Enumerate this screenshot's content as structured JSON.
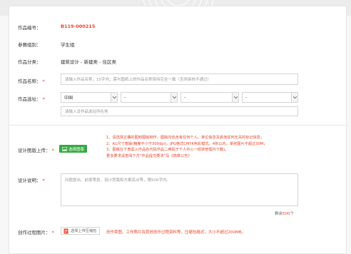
{
  "fields": {
    "work_number": {
      "label": "作品编号：",
      "value": "B119-000215"
    },
    "group": {
      "label": "参赛组别：",
      "value": "学生组"
    },
    "category": {
      "label": "作品分类：",
      "value": "建筑设计 - 新建类 - 住区类"
    },
    "work_name": {
      "label": "作品名称：",
      "required": "*",
      "placeholder": "请输入作品名称，15字内；需与图纸上的作品名称保持完全一致（否则审核不通过）"
    },
    "location": {
      "label": "作品选址：",
      "required": "*",
      "country": "中国",
      "province": "-",
      "city": "-",
      "district": "-",
      "address_placeholder": "请输入设作品选址所在地"
    },
    "design_upload": {
      "label": "设计图版上传：",
      "required": "*",
      "button_label": "选择图版",
      "notes": [
        "1、请选择正确的图到图版制作，图版内包含有任何个人、单位信息及其他任何无关的标记信息；",
        "2、A1尺寸宽版(精度不小于300dpi)，JPG格式CMYK色彩模式，4张以内，单张图片不超过30M；",
        "3、图版在下角需入作品名代码作品二维码于个人中心一经获管理内下载)。",
        "更多要求请查阅下方“作品提交要求”及《简章公告》"
      ]
    },
    "design_description": {
      "label": "设计说明：",
      "required": "*",
      "placeholder": "问题提出、前景策划、设计思路和方案亮点等，限500字内。",
      "counter_prefix": "剩余",
      "counter_value": "500",
      "counter_suffix": "个"
    },
    "process_images": {
      "label": "创作过程图片：",
      "required": "*",
      "button_label": "选择上传压缩包",
      "note": "创作草图、工作照片及其他创作过程资料等，压缩包格式，大小不超过200MB。"
    }
  },
  "colors": {
    "accent": "#e8452c",
    "upload_green": "#36a943",
    "required": "#e23b2e"
  },
  "icons": {
    "dropdown": "chevron-down-icon",
    "upload": "image-icon",
    "file": "file-icon"
  }
}
